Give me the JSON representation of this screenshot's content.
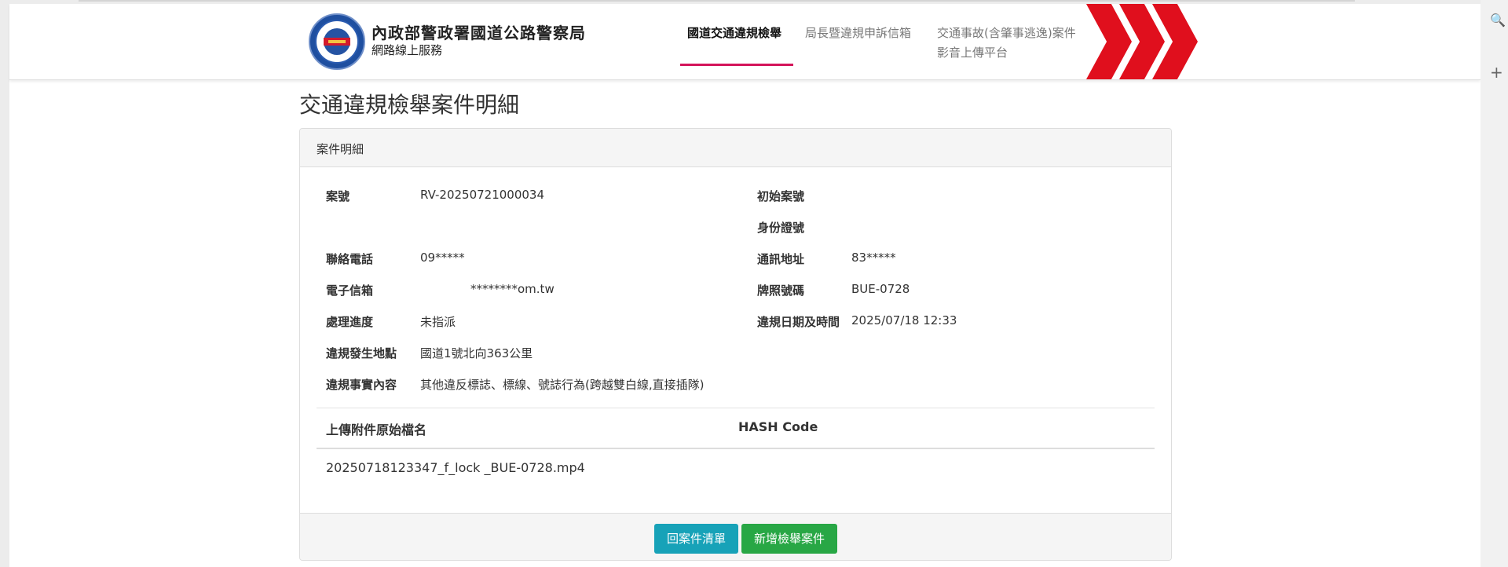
{
  "header": {
    "org_name": "內政部警政署國道公路警察局",
    "org_sub": "網路線上服務",
    "nav": [
      {
        "label": "國道交通違規檢舉"
      },
      {
        "label": "局長暨違規申訴信箱"
      },
      {
        "label_line1": "交通事故(含肇事逃逸)案件",
        "label_line2": "影音上傳平台"
      }
    ],
    "brand_color": "#e00f1d",
    "active_underline_color": "#d4145a"
  },
  "page_title": "交通違規檢舉案件明細",
  "panel": {
    "heading": "案件明細",
    "fields": {
      "case_no_label": "案號",
      "case_no": "RV-20250721000034",
      "original_case_no_label": "初始案號",
      "original_case_no": "",
      "id_no_label": "身份證號",
      "id_no": "",
      "phone_label": "聯絡電話",
      "phone": "09*****",
      "address_label": "通訊地址",
      "address": "83*****",
      "email_label": "電子信箱",
      "email": "********om.tw",
      "plate_label": "牌照號碼",
      "plate": "BUE-0728",
      "status_label": "處理進度",
      "status": "未指派",
      "datetime_label": "違規日期及時間",
      "datetime": "2025/07/18 12:33",
      "location_label": "違規發生地點",
      "location": "國道1號北向363公里",
      "content_label": "違規事實內容",
      "content": "其他違反標誌、標線、號誌行為(跨越雙白線,直接插隊)"
    },
    "attachments": {
      "col_filename": "上傳附件原始檔名",
      "col_hash": "HASH Code",
      "rows": [
        {
          "filename": "20250718123347_f_lock _BUE-0728.mp4",
          "hash": ""
        }
      ]
    },
    "buttons": {
      "back": "回案件清單",
      "new": "新增檢舉案件"
    }
  },
  "browser_side": {
    "icons": [
      "search-icon",
      "plus-icon"
    ],
    "search_glyph": "🔍",
    "plus_glyph": "+"
  }
}
